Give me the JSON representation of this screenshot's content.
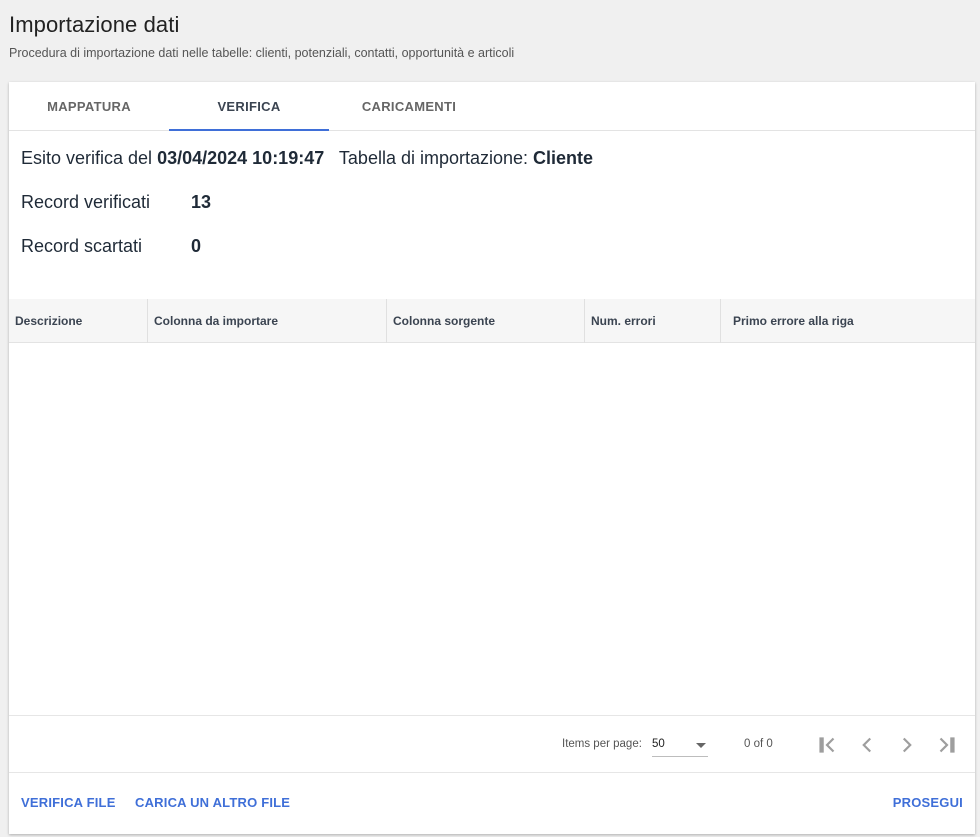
{
  "header": {
    "title": "Importazione dati",
    "subtitle": "Procedura di importazione dati nelle tabelle: clienti, potenziali, contatti, opportunità e articoli"
  },
  "tabs": [
    {
      "label": "MAPPATURA",
      "active": false
    },
    {
      "label": "VERIFICA",
      "active": true
    },
    {
      "label": "CARICAMENTI",
      "active": false
    }
  ],
  "summary": {
    "check_prefix": "Esito verifica del",
    "check_datetime": "03/04/2024 10:19:47",
    "table_prefix": "Tabella di importazione:",
    "table_name": "Cliente",
    "verified_label": "Record verificati",
    "verified_value": "13",
    "discarded_label": "Record scartati",
    "discarded_value": "0"
  },
  "table": {
    "columns": [
      "Descrizione",
      "Colonna da importare",
      "Colonna sorgente",
      "Num. errori",
      "Primo errore alla riga"
    ],
    "rows": []
  },
  "paginator": {
    "items_per_page_label": "Items per page:",
    "items_per_page_value": "50",
    "range_label": "0 of 0"
  },
  "actions": {
    "verify": "VERIFICA FILE",
    "upload_another": "CARICA UN ALTRO FILE",
    "proceed": "PROSEGUI"
  },
  "colors": {
    "accent": "#3f6fd8",
    "page_background": "#f0f0f0"
  },
  "icons": [
    "first-page-icon",
    "previous-page-icon",
    "next-page-icon",
    "last-page-icon",
    "dropdown-arrow-icon"
  ]
}
